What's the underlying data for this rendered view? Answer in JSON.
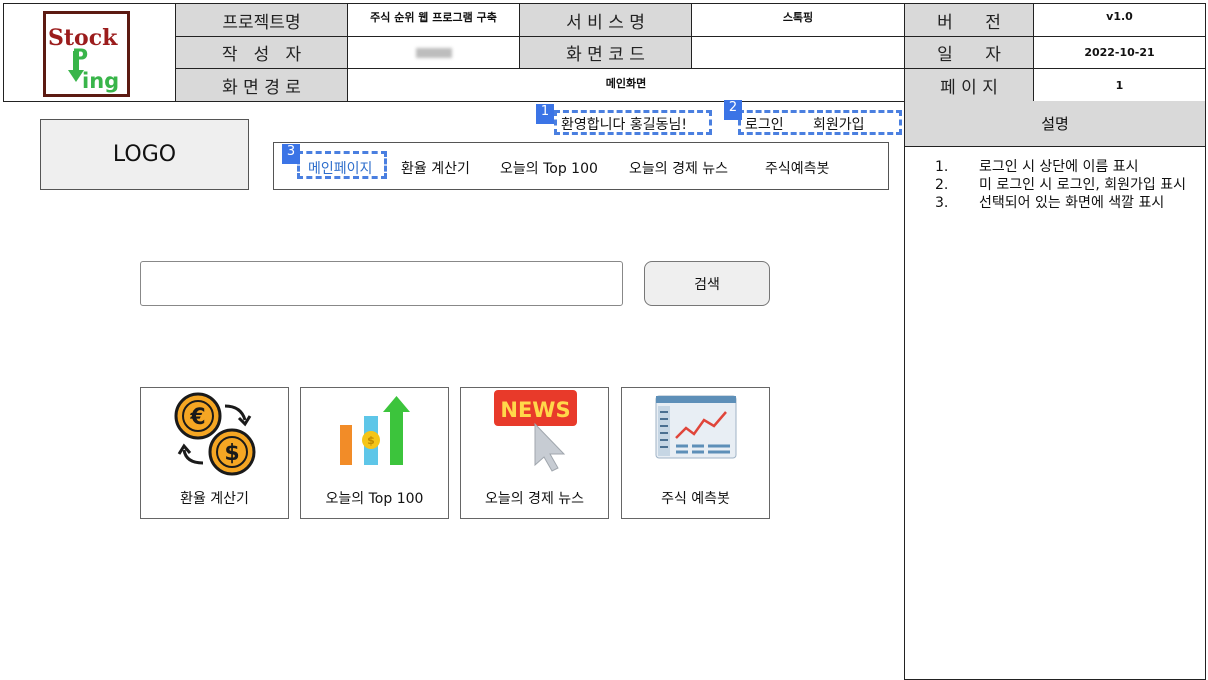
{
  "header": {
    "logo": {
      "word1": "Stock",
      "word2": "Ping"
    },
    "project_name_label": "프로젝트명",
    "project_name": "주식 순위 웹 프로그램 구축",
    "service_name_label": "서 비 스 명",
    "service_name": "스톡핑",
    "version_label": "버      전",
    "version": "v1.0",
    "author_label": "작   성   자",
    "author": "",
    "screen_code_label": "화 면 코 드",
    "screen_code": "",
    "date_label": "일      자",
    "date": "2022-10-21",
    "screen_path_label": "화 면 경 로",
    "screen_path": "메인화면",
    "page_label": "페 이 지",
    "page": "1"
  },
  "screen": {
    "logo_text": "LOGO",
    "welcome": "환영합니다 홍길동님!",
    "login": "로그인",
    "signup": "회원가입",
    "nav": [
      "메인페이지",
      "환율 계산기",
      "오늘의 Top 100",
      "오늘의 경제 뉴스",
      "주식예측봇"
    ],
    "search_button": "검색",
    "search_value": "",
    "cards": [
      "환율 계산기",
      "오늘의 Top 100",
      "오늘의 경제 뉴스",
      "주식 예측봇"
    ],
    "news_icon_text": "NEWS",
    "badges": [
      "1",
      "2",
      "3"
    ]
  },
  "description": {
    "title": "설명",
    "items": [
      {
        "num": "1.",
        "text": "로그인 시 상단에 이름 표시"
      },
      {
        "num": "2.",
        "text": "미 로그인 시 로그인, 회원가입 표시"
      },
      {
        "num": "3.",
        "text": "선택되어 있는 화면에 색깔 표시"
      }
    ]
  },
  "colors": {
    "highlight": "#4a7fe0",
    "badge": "#3b74e6",
    "label_bg": "#d9d9d9",
    "logo_red": "#9b1c1c",
    "logo_green": "#39b54a"
  },
  "icons": [
    "exchange-coins-icon",
    "bar-chart-growth-icon",
    "news-cursor-icon",
    "stock-dashboard-icon"
  ]
}
